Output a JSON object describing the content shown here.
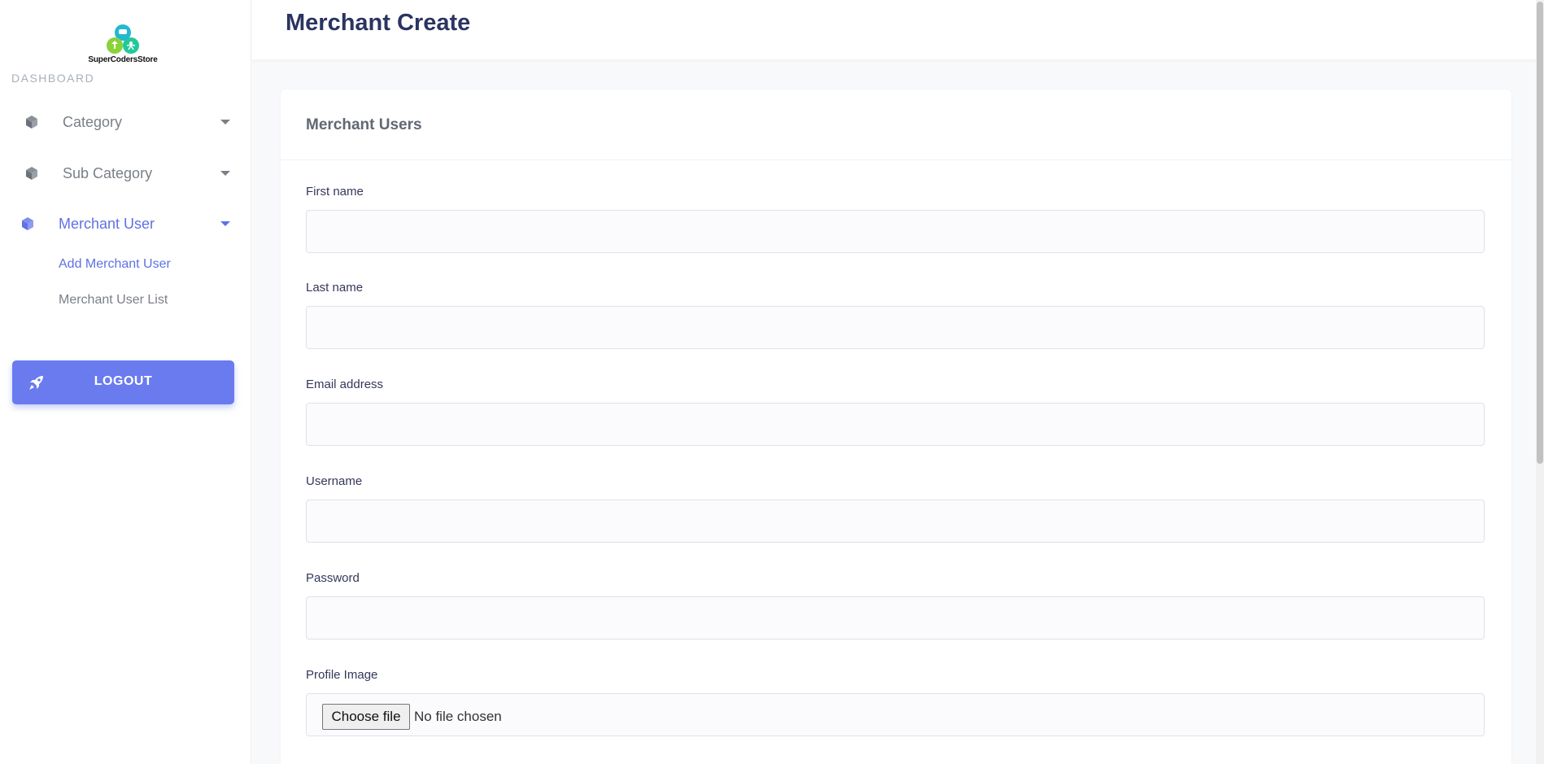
{
  "sidebar": {
    "logo_text": "SuperCodersStore",
    "dashboard_label": "DASHBOARD",
    "nav": [
      {
        "label": "Category"
      },
      {
        "label": "Sub Category"
      },
      {
        "label": "Merchant User"
      }
    ],
    "sub_items": [
      {
        "label": "Add Merchant User"
      },
      {
        "label": "Merchant User List"
      }
    ],
    "logout_label": "LOGOUT"
  },
  "header": {
    "title": "Merchant Create"
  },
  "card": {
    "title": "Merchant Users",
    "fields": {
      "first_name": {
        "label": "First name",
        "value": ""
      },
      "last_name": {
        "label": "Last name",
        "value": ""
      },
      "email": {
        "label": "Email address",
        "value": ""
      },
      "username": {
        "label": "Username",
        "value": ""
      },
      "password": {
        "label": "Password",
        "value": ""
      },
      "profile_image": {
        "label": "Profile Image",
        "button": "Choose file",
        "status": "No file chosen"
      }
    }
  },
  "colors": {
    "accent": "#5e72e4",
    "logout_bg": "#6a7bef",
    "title": "#2b3460"
  }
}
